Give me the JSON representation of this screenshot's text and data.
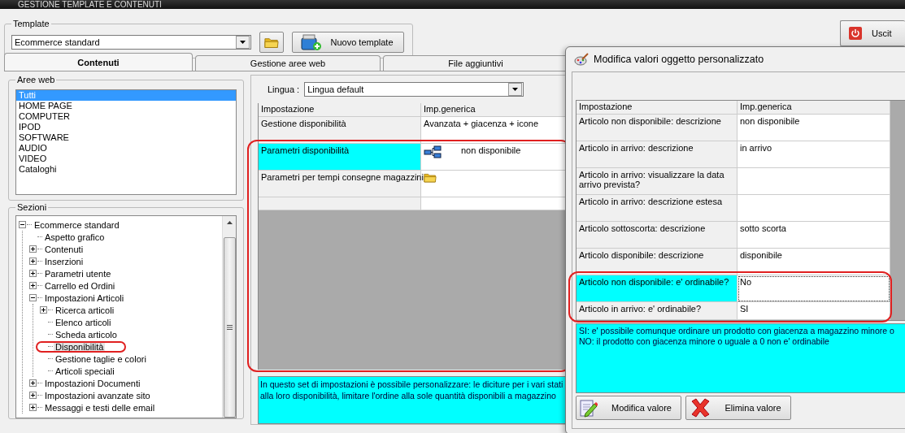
{
  "window": {
    "title": "GESTIONE TEMPLATE E CONTENUTI"
  },
  "template": {
    "label": "Template",
    "value": "Ecommerce standard",
    "new_button": "Nuovo template"
  },
  "exit_button": "Uscit",
  "tabs": [
    {
      "label": "Contenuti",
      "selected": true
    },
    {
      "label": "Gestione aree web",
      "selected": false
    },
    {
      "label": "File aggiuntivi",
      "selected": false
    }
  ],
  "web_areas": {
    "label": "Aree web",
    "items": [
      {
        "label": "Tutti",
        "selected": true
      },
      {
        "label": "HOME PAGE",
        "selected": false
      },
      {
        "label": "COMPUTER",
        "selected": false
      },
      {
        "label": "IPOD",
        "selected": false
      },
      {
        "label": "SOFTWARE",
        "selected": false
      },
      {
        "label": "AUDIO",
        "selected": false
      },
      {
        "label": "VIDEO",
        "selected": false
      },
      {
        "label": "Cataloghi",
        "selected": false
      }
    ]
  },
  "sections": {
    "label": "Sezioni",
    "tree": [
      {
        "label": "Ecommerce standard",
        "expanded": true,
        "selected": false,
        "children": [
          {
            "label": "Aspetto grafico",
            "selected": false
          },
          {
            "label": "Contenuti",
            "expanded": false,
            "selected": false
          },
          {
            "label": "Inserzioni",
            "expanded": false,
            "selected": false
          },
          {
            "label": "Parametri utente",
            "expanded": false,
            "selected": false
          },
          {
            "label": "Carrello ed Ordini",
            "expanded": false,
            "selected": false
          },
          {
            "label": "Impostazioni Articoli",
            "expanded": true,
            "selected": false,
            "children": [
              {
                "label": "Ricerca articoli",
                "expanded": false,
                "selected": false
              },
              {
                "label": "Elenco articoli",
                "selected": false
              },
              {
                "label": "Scheda articolo",
                "selected": false
              },
              {
                "label": "Disponibilità",
                "selected": true
              },
              {
                "label": "Gestione taglie e colori",
                "selected": false
              },
              {
                "label": "Articoli speciali",
                "selected": false
              }
            ]
          },
          {
            "label": "Impostazioni Documenti",
            "expanded": false,
            "selected": false
          },
          {
            "label": "Impostazioni avanzate sito",
            "expanded": false,
            "selected": false
          },
          {
            "label": "Messaggi e testi delle email",
            "expanded": false,
            "selected": false
          }
        ]
      }
    ]
  },
  "language": {
    "label": "Lingua :",
    "value": "Lingua default"
  },
  "settings_table": {
    "columns": [
      "Impostazione",
      "Imp.generica"
    ],
    "rows": [
      {
        "setting": "Gestione disponibilità",
        "value": "Avanzata + giacenza + icone",
        "kind": "text",
        "selected": false
      },
      {
        "setting": "Parametri disponibilità",
        "value": "non disponibile",
        "kind": "object",
        "selected": true
      },
      {
        "setting": "Parametri per tempi consegne magazzini",
        "kind": "folder",
        "selected": false
      }
    ]
  },
  "description": [
    "In questo set di impostazioni è possibile personalizzare: le diciture per i vari stati",
    "alla loro disponibilità, limitare l'ordine alla sole quantità disponibili a magazzino"
  ],
  "dialog": {
    "title": "Modifica valori oggetto personalizzato",
    "columns": [
      "Impostazione",
      "Imp.generica"
    ],
    "rows": [
      {
        "setting": "Articolo non disponibile: descrizione",
        "value": "non disponibile",
        "selected": false
      },
      {
        "setting": "Articolo in arrivo: descrizione",
        "value": "in arrivo",
        "selected": false
      },
      {
        "setting": "Articolo in arrivo: visualizzare la data arrivo prevista?",
        "selected": false
      },
      {
        "setting": "Articolo in arrivo: descrizione estesa",
        "selected": false
      },
      {
        "setting": "Articolo sottoscorta: descrizione",
        "value": "sotto scorta",
        "selected": false
      },
      {
        "setting": "Articolo disponibile: descrizione",
        "value": "disponibile",
        "selected": false
      },
      {
        "setting": "Articolo non disponibile: e' ordinabile?",
        "value": "No",
        "selected": true
      },
      {
        "setting": "Articolo in arrivo: e' ordinabile?",
        "value": "SI",
        "selected": false
      }
    ],
    "description": [
      "SI: e' possibile comunque ordinare un prodotto con giacenza a magazzino minore o",
      "NO: il prodotto con giacenza minore o uguale a 0 non e' ordinabile"
    ],
    "buttons": [
      {
        "label": "Modifica valore",
        "kind": "edit"
      },
      {
        "label": "Elimina valore",
        "kind": "delete"
      }
    ]
  }
}
